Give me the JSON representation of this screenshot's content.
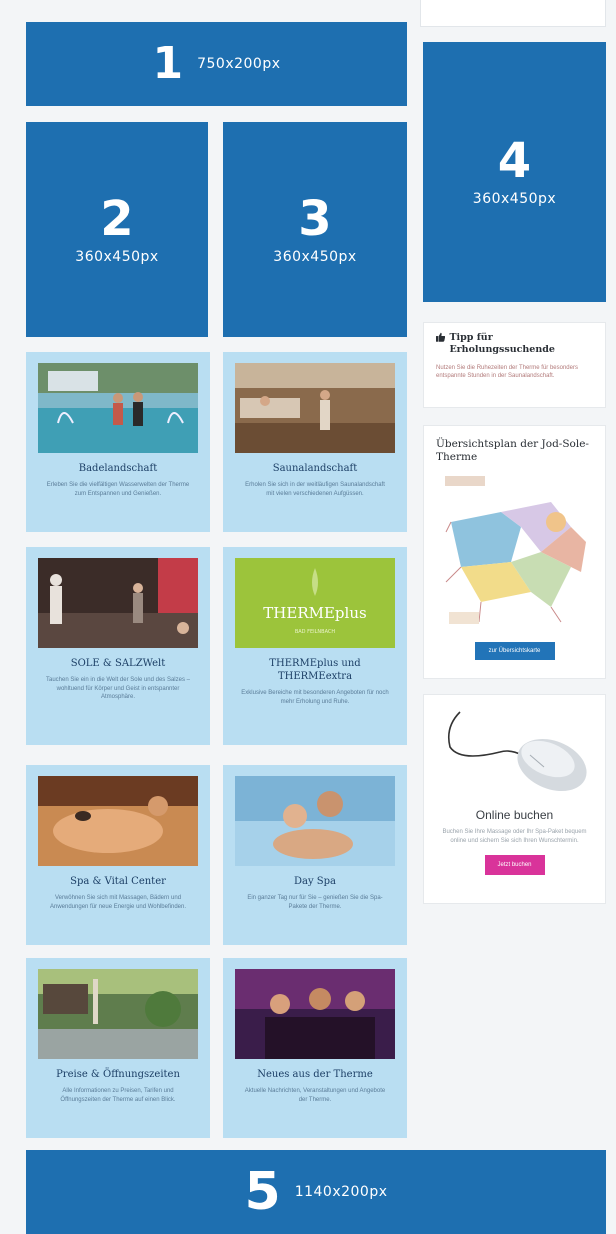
{
  "banners": {
    "b1": {
      "num": "1",
      "size": "750x200px"
    },
    "b2": {
      "num": "2",
      "size": "360x450px"
    },
    "b3": {
      "num": "3",
      "size": "360x450px"
    },
    "b4": {
      "num": "4",
      "size": "360x450px"
    },
    "b5": {
      "num": "5",
      "size": "1140x200px"
    }
  },
  "cards": [
    {
      "title": "Badelandschaft",
      "desc": "Erleben Sie die vielfältigen Wasserwelten der Therme zum Entspannen und Genießen."
    },
    {
      "title": "Saunalandschaft",
      "desc": "Erholen Sie sich in der weitläufigen Saunalandschaft mit vielen verschiedenen Aufgüssen."
    },
    {
      "title": "SOLE & SALZWelt",
      "desc": "Tauchen Sie ein in die Welt der Sole und des Salzes – wohltuend für Körper und Geist in entspannter Atmosphäre."
    },
    {
      "title": "THERMEplus und THERMEextra",
      "desc": "Exklusive Bereiche mit besonderen Angeboten für noch mehr Erholung und Ruhe."
    },
    {
      "title": "Spa & Vital Center",
      "desc": "Verwöhnen Sie sich mit Massagen, Bädern und Anwendungen für neue Energie und Wohlbefinden."
    },
    {
      "title": "Day Spa",
      "desc": "Ein ganzer Tag nur für Sie – genießen Sie die Spa-Pakete der Therme."
    },
    {
      "title": "Preise & Öffnungszeiten",
      "desc": "Alle Informationen zu Preisen, Tarifen und Öffnungszeiten der Therme auf einen Blick."
    },
    {
      "title": "Neues aus der Therme",
      "desc": "Aktuelle Nachrichten, Veranstaltungen und Angebote der Therme."
    }
  ],
  "tipp": {
    "title": "Tipp für Erholungssuchende",
    "text": "Nutzen Sie die Ruhezeiten der Therme für besonders entspannte Stunden in der Saunalandschaft."
  },
  "plan": {
    "title": "Übersichtsplan der Jod-Sole-Therme",
    "button": "zur Übersichtskarte"
  },
  "buchen": {
    "title": "Online buchen",
    "text": "Buchen Sie Ihre Massage oder Ihr Spa-Paket bequem online und sichern Sie sich Ihren Wunschtermin.",
    "button": "Jetzt buchen"
  },
  "colors": {
    "banner_blue": "#1e6fb0",
    "card_bg": "#b9def2",
    "button_blue": "#2274b8",
    "button_pink": "#d9339a"
  },
  "icons": {
    "tipp": "thumbs-up-icon"
  }
}
